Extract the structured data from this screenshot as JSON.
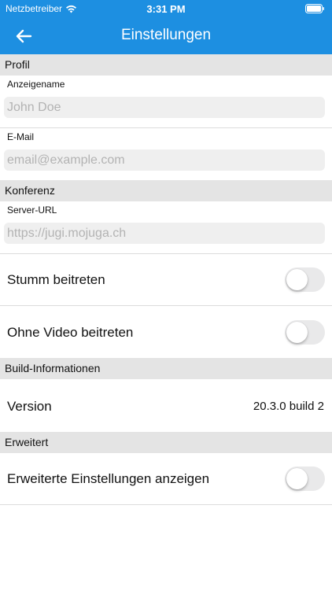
{
  "status_bar": {
    "carrier": "Netzbetreiber",
    "time": "3:31 PM"
  },
  "nav": {
    "title": "Einstellungen"
  },
  "colors": {
    "accent": "#1d8fe1",
    "section_bg": "#e4e4e4",
    "toggle_off": "#e9e9ea"
  },
  "profile": {
    "header": "Profil",
    "display_name": {
      "label": "Anzeigename",
      "placeholder": "John Doe"
    },
    "email": {
      "label": "E-Mail",
      "placeholder": "email@example.com"
    }
  },
  "conference": {
    "header": "Konferenz",
    "server_url": {
      "label": "Server-URL",
      "placeholder": "https://jugi.mojuga.ch"
    },
    "start_muted": {
      "label": "Stumm beitreten",
      "on": false
    },
    "no_video": {
      "label": "Ohne Video beitreten",
      "on": false
    }
  },
  "build": {
    "header": "Build-Informationen",
    "version_label": "Version",
    "version_value": "20.3.0 build 2"
  },
  "advanced": {
    "header": "Erweitert",
    "show_advanced": {
      "label": "Erweiterte Einstellungen anzeigen",
      "on": false
    }
  }
}
